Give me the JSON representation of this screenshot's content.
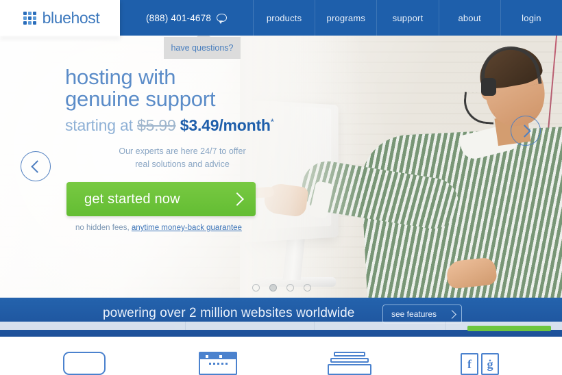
{
  "header": {
    "logo": {
      "text": "bluehost",
      "icon": "grid-icon"
    },
    "phone": {
      "number": "(888) 401-4678",
      "icon": "chat-bubble-icon"
    },
    "nav_items": [
      {
        "label": "products"
      },
      {
        "label": "programs"
      },
      {
        "label": "support"
      },
      {
        "label": "about"
      },
      {
        "label": "login"
      }
    ],
    "tooltip": "have questions?",
    "bg_color": "#1e5fab"
  },
  "hero": {
    "headline_line1": "hosting with",
    "headline_line2": "genuine support",
    "price_prefix": "starting at",
    "price_old": "$5.99",
    "price_new": "$3.49/month",
    "price_asterisk": "*",
    "subtext_line1": "Our experts are here 24/7 to offer",
    "subtext_line2": "real solutions and advice",
    "cta_label": "get started now",
    "cta_icon": "chevron-right-icon",
    "cta_color": "#6bc23c",
    "fineprint_prefix": "no hidden fees, ",
    "fineprint_link": "anytime money-back guarantee",
    "prev_icon": "chevron-left-icon",
    "next_icon": "chevron-right-icon",
    "carousel_dots": 4,
    "carousel_active_index": 1,
    "headline_color": "#5b8cc8",
    "price_accent_color": "#1f5fab"
  },
  "banner": {
    "text": "powering over 2 million websites worldwide",
    "button_label": "see features",
    "button_icon": "chevron-right-icon",
    "bg_color": "#2463ad",
    "accent_bar_color": "#6dc63f"
  },
  "features": [
    {
      "name": "search-box-icon"
    },
    {
      "name": "browser-window-icon"
    },
    {
      "name": "stacked-layers-icon"
    },
    {
      "name": "social-icons"
    }
  ],
  "social": [
    {
      "glyph": "f",
      "name": "facebook-icon"
    },
    {
      "glyph": "ġ",
      "name": "google-plus-icon"
    }
  ]
}
